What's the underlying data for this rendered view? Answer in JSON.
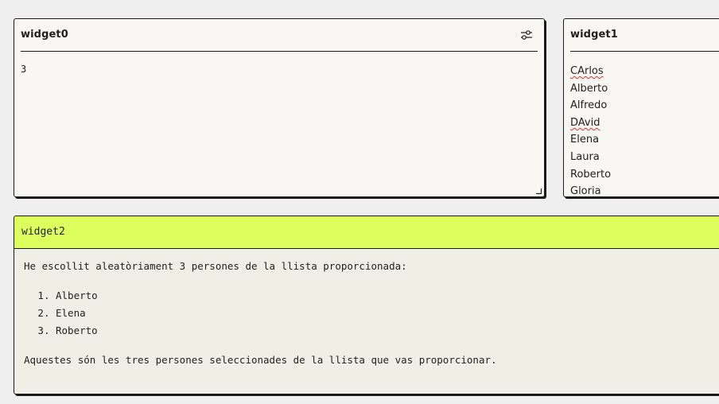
{
  "widget0": {
    "title": "widget0",
    "value": "3",
    "settings_icon": "sliders-icon",
    "resize_icon": "resize-handle-icon"
  },
  "widget1": {
    "title": "widget1",
    "names": [
      {
        "text": "CArlos",
        "spellcheck_flag": true
      },
      {
        "text": "Alberto",
        "spellcheck_flag": false
      },
      {
        "text": "Alfredo",
        "spellcheck_flag": false
      },
      {
        "text": "DAvid",
        "spellcheck_flag": true
      },
      {
        "text": "Elena",
        "spellcheck_flag": false
      },
      {
        "text": "Laura",
        "spellcheck_flag": false
      },
      {
        "text": "Roberto",
        "spellcheck_flag": false
      },
      {
        "text": "Gloria",
        "spellcheck_flag": false
      }
    ]
  },
  "widget2": {
    "title": "widget2",
    "intro": "He escollit aleatòriament 3 persones de la llista proporcionada:",
    "selected": [
      "Alberto",
      "Elena",
      "Roberto"
    ],
    "outro": "Aquestes són les tres persones seleccionades de la llista que vas proporcionar."
  },
  "colors": {
    "background": "#efefef",
    "card": "#f8f7f3",
    "output_card": "#f0efe5",
    "output_header": "#dcff5e",
    "border": "#1a1a1a",
    "spellcheck": "#d9322b"
  }
}
